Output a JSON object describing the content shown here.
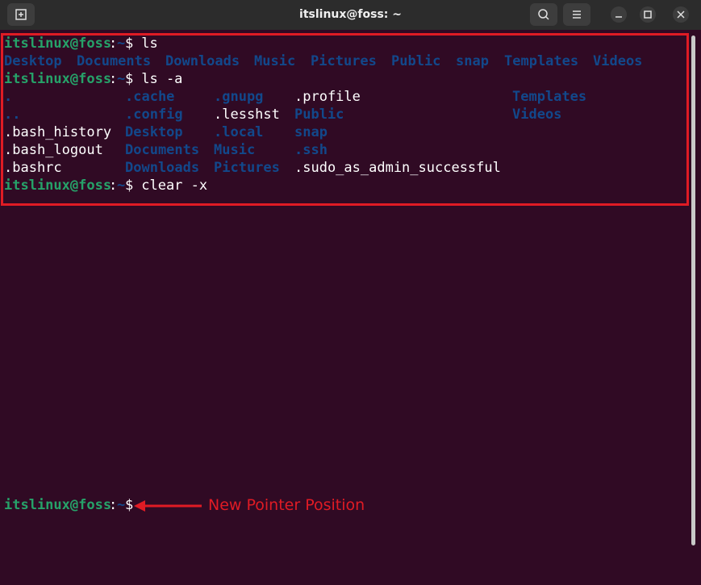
{
  "window": {
    "title": "itslinux@foss: ~",
    "buttons": {
      "new_tab": "new-tab-icon",
      "search": "search-icon",
      "menu": "hamburger-menu-icon",
      "minimize": "minimize-icon",
      "maximize": "maximize-icon",
      "close": "close-icon"
    }
  },
  "prompt": {
    "user_host": "itslinux@foss",
    "colon": ":",
    "path": "~",
    "dollar": "$"
  },
  "commands": {
    "ls": " ls",
    "ls_a": " ls -a",
    "clear": " clear -x"
  },
  "ls_output": [
    "Desktop",
    "Documents",
    "Downloads",
    "Music",
    "Pictures",
    "Public",
    "snap",
    "Templates",
    "Videos"
  ],
  "ls_a_output": {
    "dot": ".",
    "dotdot": "..",
    "bash_history": ".bash_history",
    "bash_logout": ".bash_logout",
    "bashrc": ".bashrc",
    "cache": ".cache",
    "config": ".config",
    "desktop": "Desktop",
    "documents": "Documents",
    "downloads": "Downloads",
    "gnupg": ".gnupg",
    "lesshst": ".lesshst",
    "local": ".local",
    "music": "Music",
    "pictures": "Pictures",
    "profile": ".profile",
    "public": "Public",
    "snap": "snap",
    "ssh": ".ssh",
    "sudo": ".sudo_as_admin_successful",
    "templates": "Templates",
    "videos": "Videos"
  },
  "annotation": {
    "label": "New Pointer Position"
  },
  "colors": {
    "background": "#300a24",
    "user": "#26a269",
    "directory": "#12488b",
    "highlight": "#e01b24"
  }
}
